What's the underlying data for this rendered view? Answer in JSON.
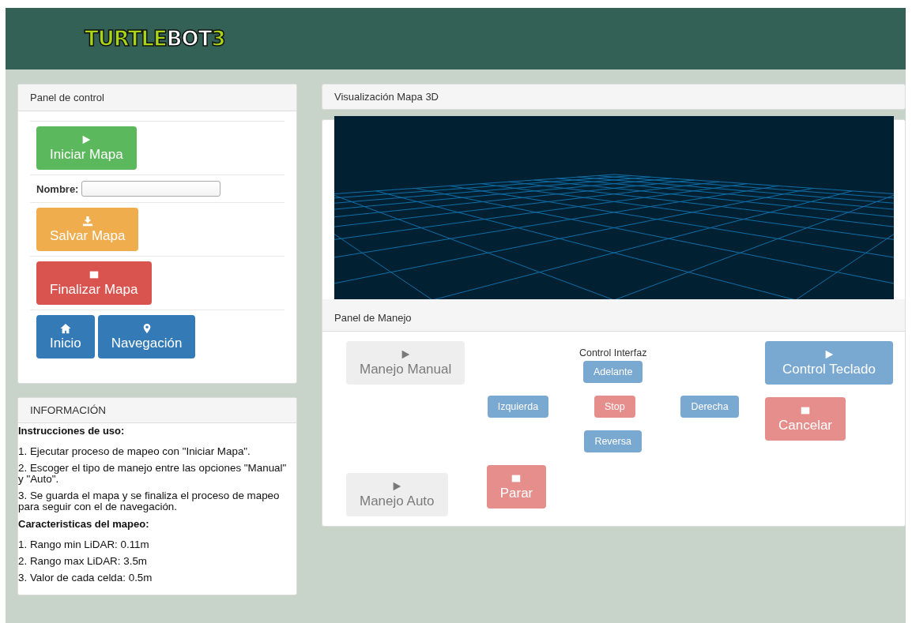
{
  "header": {
    "logo": [
      "TURTLE",
      "BOT",
      "3"
    ]
  },
  "control_panel": {
    "title": "Panel de control",
    "start_button": {
      "label": "Iniciar Mapa",
      "kind": "success"
    },
    "name_field": {
      "label": "Nombre:"
    },
    "save_button": {
      "label": "Salvar Mapa",
      "kind": "warning"
    },
    "finish_button": {
      "label": "Finalizar Mapa",
      "kind": "danger"
    },
    "nav_buttons": [
      {
        "label": "Inicio",
        "kind": "primary"
      },
      {
        "label": "Navegación",
        "kind": "primary"
      }
    ]
  },
  "info": {
    "title": "INFORMACIÓN",
    "sections": [
      {
        "heading": "Instrucciones de uso:",
        "items": [
          "1. Ejecutar proceso de mapeo con \"Iniciar Mapa\".",
          "2. Escoger el tipo de manejo entre las opciones \"Manual\" y \"Auto\".",
          "3. Se guarda el mapa y se finaliza el proceso de mapeo para seguir con el de navegación."
        ]
      },
      {
        "heading": "Caracteristicas del mapeo:",
        "items": [
          "1. Rango min LiDAR: 0.11m",
          "2. Rango max LiDAR: 3.5m",
          "3. Valor de cada celda: 0.5m"
        ]
      }
    ]
  },
  "map_view": {
    "title": "Visualización Mapa 3D"
  },
  "drive_panel": {
    "title": "Panel de Manejo",
    "manual_button": {
      "label": "Manejo Manual",
      "kind": "default",
      "disabled": true
    },
    "auto_button": {
      "label": "Manejo Auto",
      "kind": "default",
      "disabled": true
    },
    "interface_title": "Control Interfaz",
    "forward": {
      "label": "Adelante",
      "kind": "primary",
      "disabled": true
    },
    "left": {
      "label": "Izquierda",
      "kind": "primary",
      "disabled": true
    },
    "stop": {
      "label": "Stop",
      "kind": "danger",
      "disabled": true
    },
    "right": {
      "label": "Derecha",
      "kind": "primary",
      "disabled": true
    },
    "reverse": {
      "label": "Reversa",
      "kind": "primary",
      "disabled": true
    },
    "halt_button": {
      "label": "Parar",
      "kind": "danger",
      "disabled": true
    },
    "keyboard_button": {
      "label": "Control Teclado",
      "kind": "primary",
      "disabled": true
    },
    "cancel_button": {
      "label": "Cancelar",
      "kind": "danger",
      "disabled": true
    }
  }
}
